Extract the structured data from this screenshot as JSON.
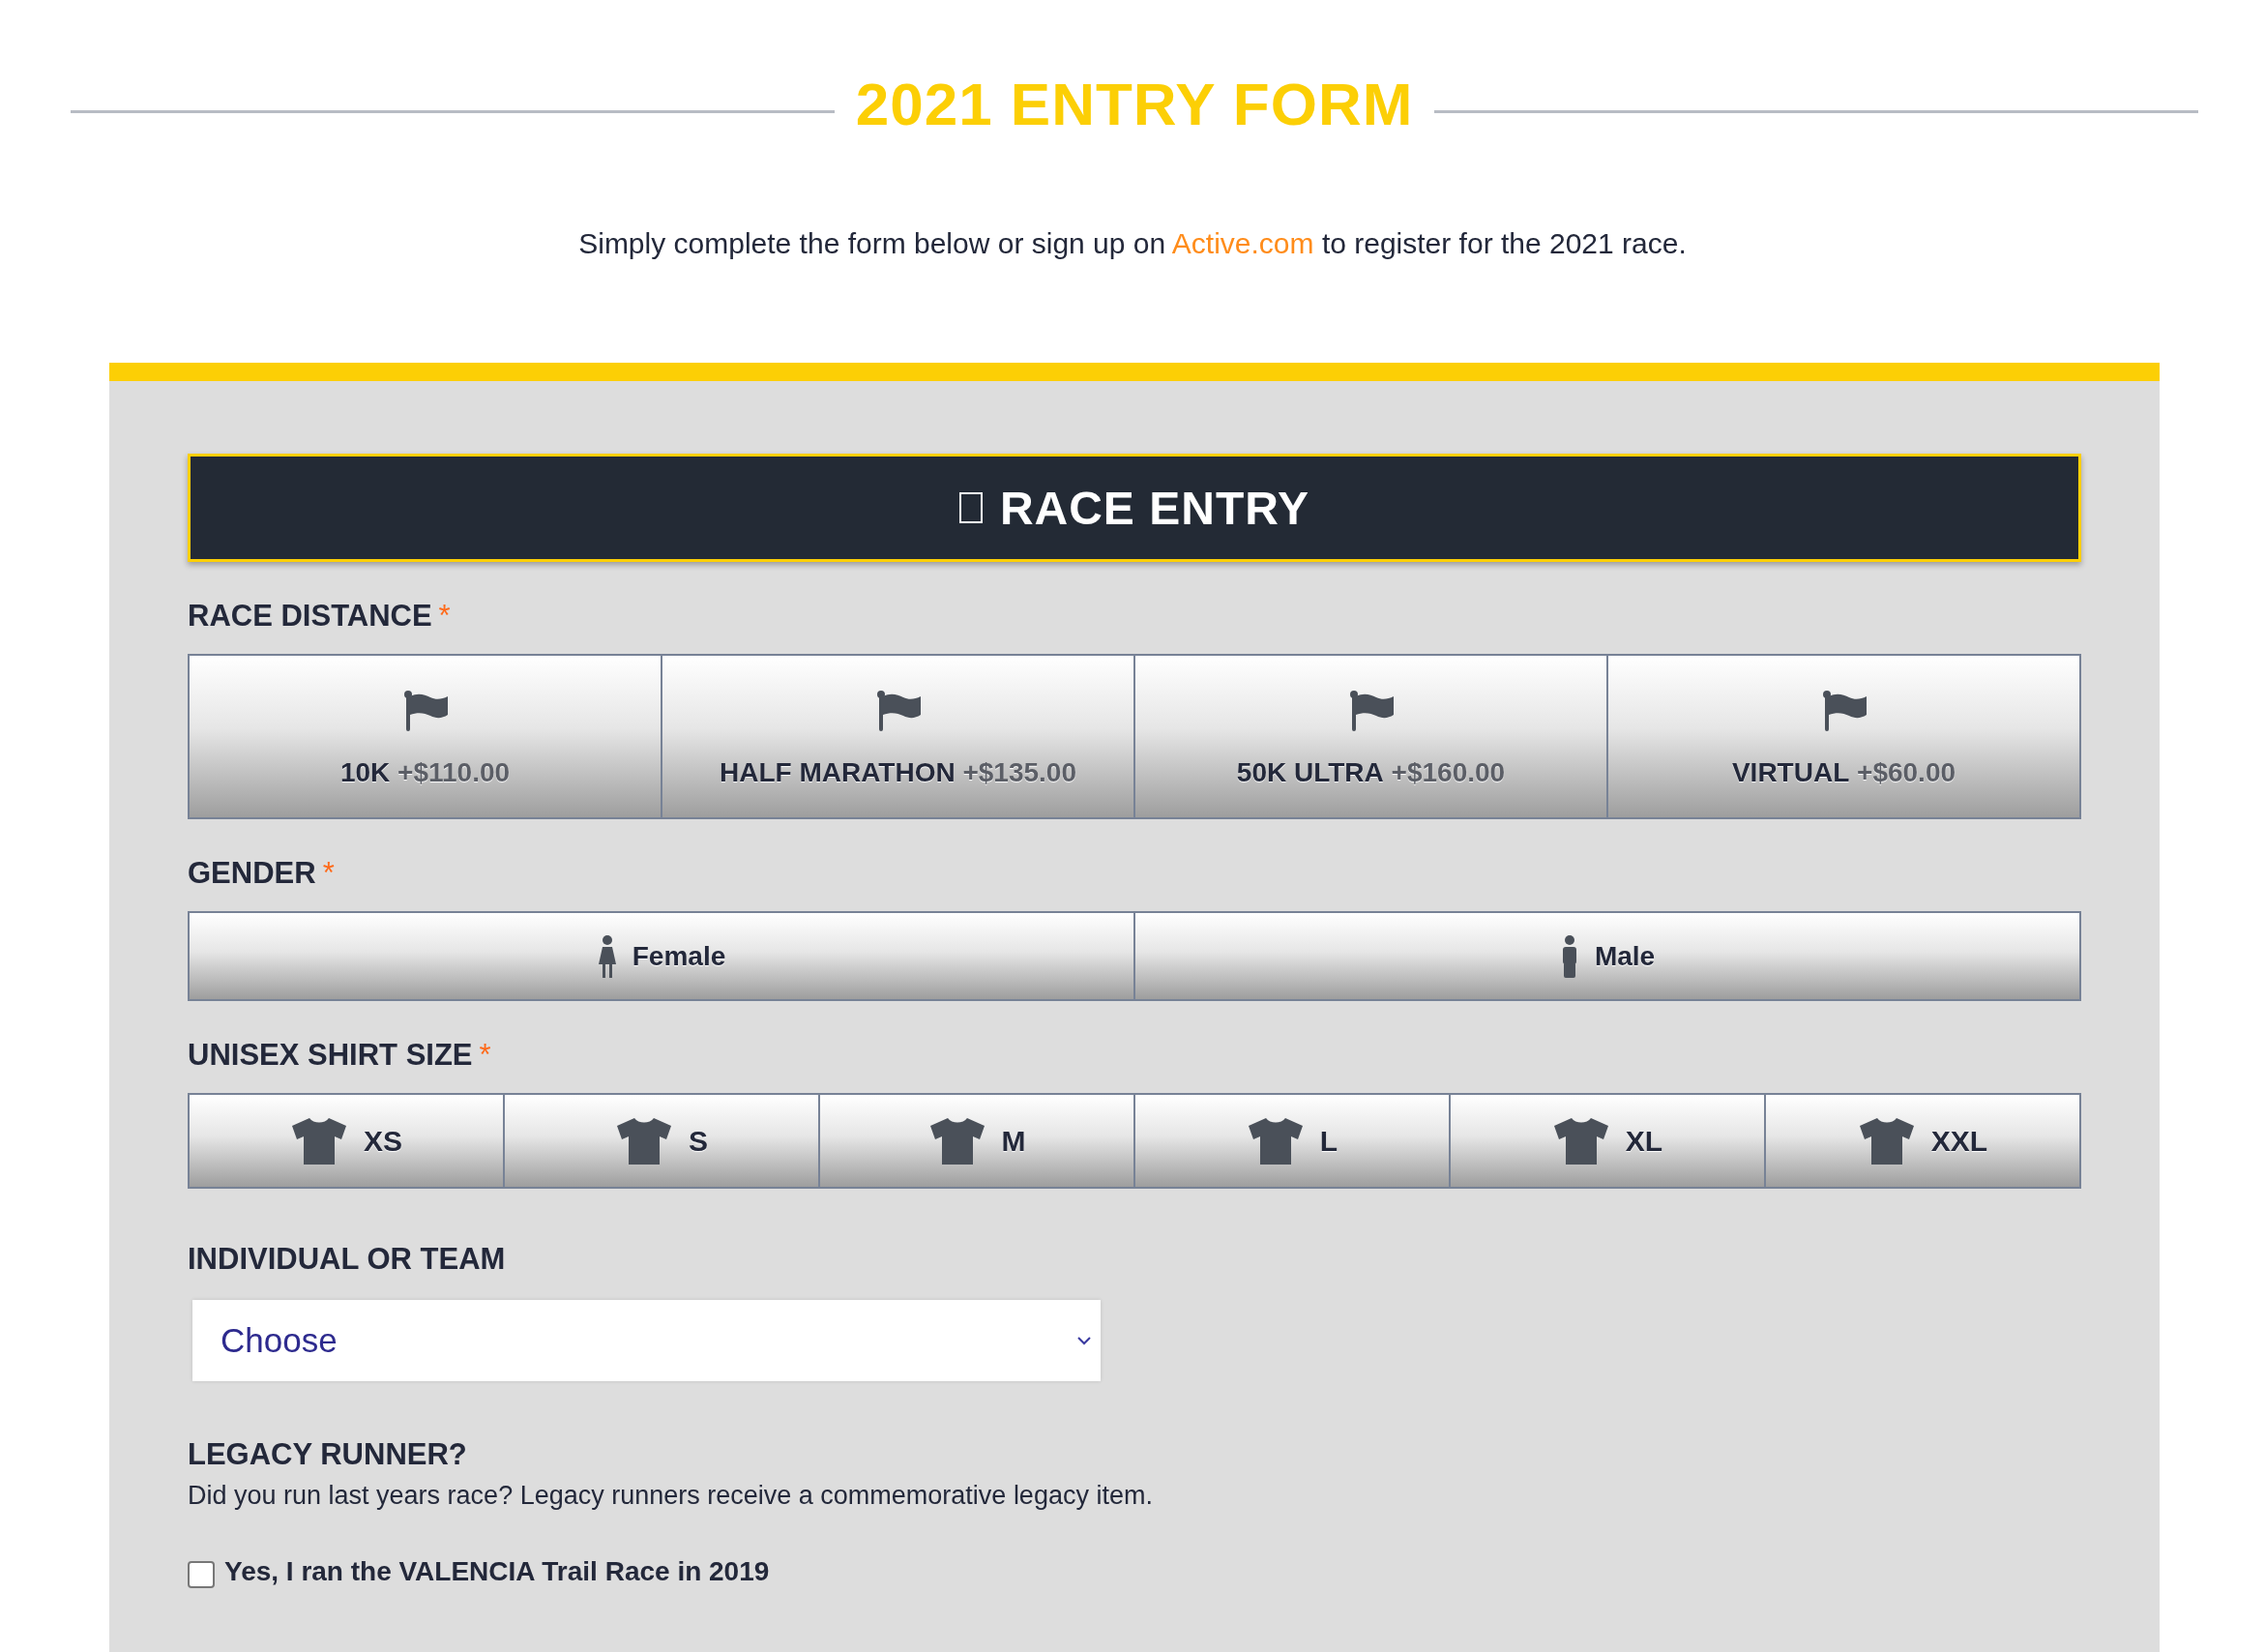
{
  "header": {
    "title": "2021 ENTRY FORM"
  },
  "intro": {
    "before": "Simply complete the form below or sign up on ",
    "link": "Active.com",
    "after": " to register for the 2021 race."
  },
  "section": {
    "title": "RACE ENTRY"
  },
  "fields": [
    {
      "kind": "distance",
      "label": "RACE DISTANCE",
      "required_mark": "*",
      "options": [
        {
          "name": "10K",
          "price": "+$110.00",
          "selected": false
        },
        {
          "name": "HALF MARATHON",
          "price": "+$135.00",
          "selected": false
        },
        {
          "name": "50K ULTRA",
          "price": "+$160.00",
          "selected": false
        },
        {
          "name": "VIRTUAL",
          "price": "+$60.00",
          "selected": false
        }
      ]
    },
    {
      "kind": "gender",
      "label": "GENDER",
      "required_mark": "*",
      "options": [
        {
          "name": "Female",
          "kind": "female",
          "selected": false
        },
        {
          "name": "Male",
          "kind": "male",
          "selected": false
        }
      ]
    },
    {
      "kind": "shirt",
      "label": "UNISEX SHIRT SIZE",
      "required_mark": "*",
      "options": [
        {
          "name": "XS",
          "selected": false
        },
        {
          "name": "S",
          "selected": false
        },
        {
          "name": "M",
          "selected": false
        },
        {
          "name": "L",
          "selected": false
        },
        {
          "name": "XL",
          "selected": false
        },
        {
          "name": "XXL",
          "selected": false
        }
      ]
    },
    {
      "kind": "select",
      "label": "INDIVIDUAL OR TEAM",
      "value": "Choose"
    },
    {
      "kind": "checkbox",
      "label": "LEGACY RUNNER?",
      "description": "Did you run last years race? Legacy runners receive a commemorative legacy item.",
      "option": "Yes, I ran the VALENCIA Trail Race in 2019",
      "checked": false
    }
  ]
}
